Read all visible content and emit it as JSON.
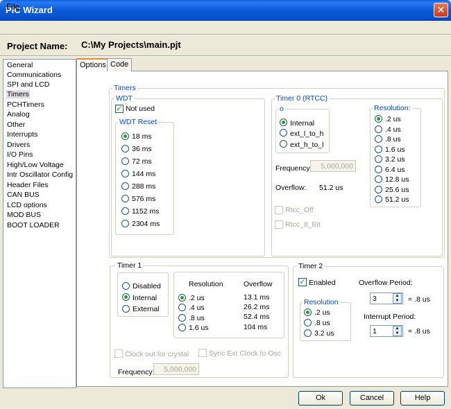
{
  "window": {
    "title": "PIC Wizard",
    "close_glyph": "✕"
  },
  "menu": {
    "file": "File"
  },
  "project": {
    "label": "Project Name:",
    "path": "C:\\My Projects\\main.pjt"
  },
  "sidebar": {
    "items": [
      "General",
      "Communications",
      "SPI and LCD",
      "Timers",
      "PCHTimers",
      "Analog",
      "Other",
      "Interrupts",
      "Drivers",
      "I/O Pins",
      "High/Low Voltage",
      "Intr Oscillator Config",
      "Header Files",
      "CAN BUS",
      "LCD options",
      "MOD BUS",
      "BOOT LOADER"
    ],
    "selected": "Timers"
  },
  "tabs": [
    "Options",
    "Code"
  ],
  "timers": {
    "group": "Timers",
    "wdt": {
      "label": "WDT",
      "not_used": "Not used",
      "reset_label": "WDT Reset",
      "options": [
        "18 ms",
        "36 ms",
        "72 ms",
        "144 ms",
        "288 ms",
        "576 ms",
        "1152 ms",
        "2304 ms"
      ],
      "selected": "18 ms"
    },
    "timer0": {
      "label": "Timer 0 (RTCC)",
      "source_label": "o",
      "sources": [
        "Internal",
        "ext_l_to_h",
        "ext_h_to_l"
      ],
      "source_selected": "Internal",
      "frequency_label": "Frequency:",
      "frequency_value": "5,000,000",
      "overflow_label": "Overflow:",
      "overflow_value": "51.2 us",
      "rtcc_off": "Rtcc_Off",
      "rtcc_8bit": "Rtcc_8_Bit",
      "resolution_label": "Resolution:",
      "resolutions": [
        ".2 us",
        ".4 us",
        ".8 us",
        "1.6 us",
        "3.2 us",
        "6.4 us",
        "12.8 us",
        "25.6 us",
        "51.2 us"
      ],
      "resolution_selected": ".2 us"
    },
    "timer1": {
      "label": "Timer 1",
      "modes": [
        "Disabled",
        "Internal",
        "External"
      ],
      "mode_selected": "Internal",
      "resolution_header": "Resolution",
      "overflow_header": "Overflow",
      "resolutions": [
        ".2 us",
        ".4 us",
        ".8 us",
        "1.6 us"
      ],
      "overflows": [
        "13.1 ms",
        "26.2 ms",
        "52.4 ms",
        "104 ms"
      ],
      "resolution_selected": ".2 us",
      "clock_out": "Clock out for crystal",
      "sync_ext": "Sync Ext Clock to Osc",
      "frequency_label": "Frequency:",
      "frequency_value": "5,000,000"
    },
    "timer2": {
      "label": "Timer 2",
      "enabled": "Enabled",
      "resolution_label": "Resolution",
      "resolutions": [
        ".2 us",
        ".8 us",
        "3.2 us"
      ],
      "resolution_selected": ".2 us",
      "overflow_period_label": "Overflow Period:",
      "overflow_period_value": "3",
      "overflow_period_result": "= .8 us",
      "interrupt_period_label": "Interrupt Period:",
      "interrupt_period_value": "1",
      "interrupt_period_result": "= .8 us"
    }
  },
  "buttons": {
    "ok": "Ok",
    "cancel": "Cancel",
    "help": "Help"
  },
  "colors": {
    "titlebar": "#0a5ad8",
    "group_label": "#0046d5",
    "radio_dot": "#21a121"
  }
}
